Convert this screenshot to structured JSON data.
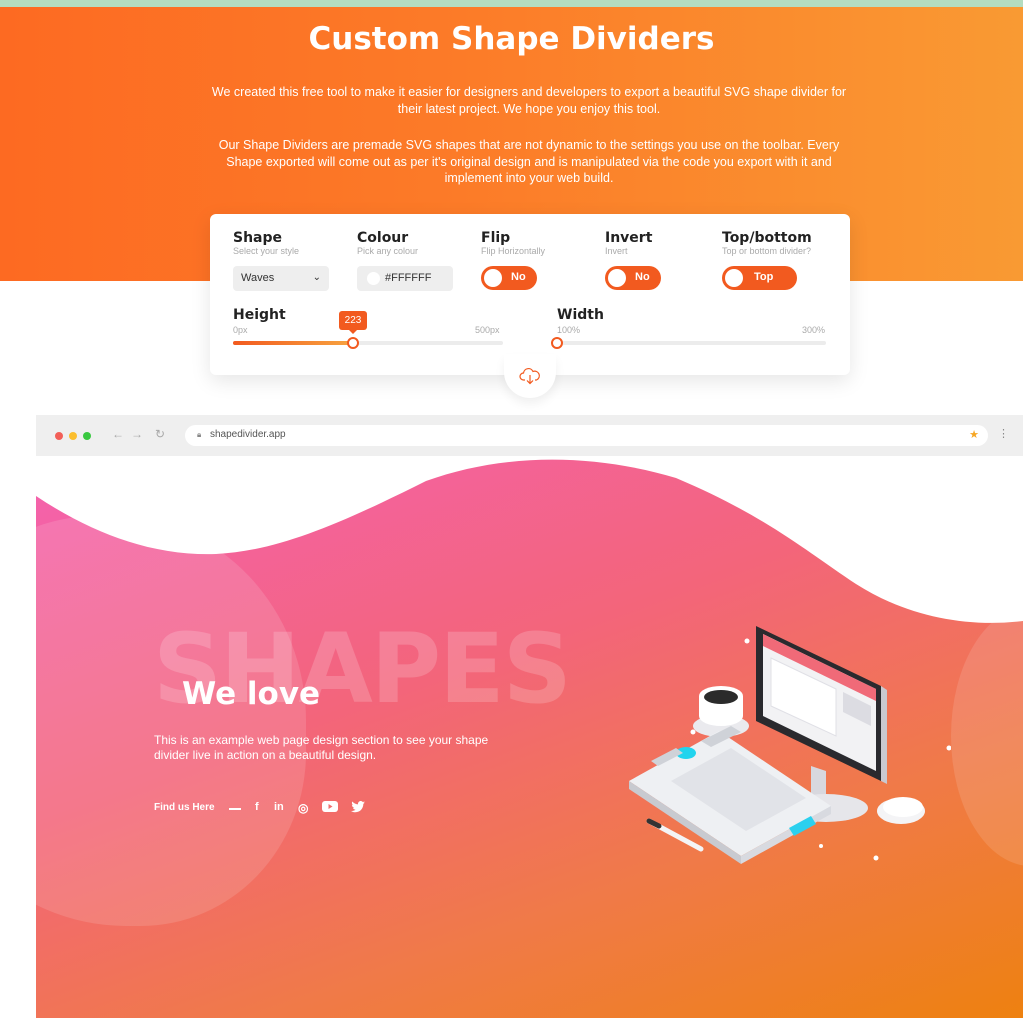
{
  "page": {
    "title": "Custom Shape Dividers",
    "intro_line1": "We created this free tool to make it easier for designers and developers to export a beautiful SVG shape divider for their latest project. We hope you enjoy this tool.",
    "intro_line2": "Our Shape Dividers are premade SVG shapes that are not dynamic to the settings you use on the toolbar. Every Shape exported will come out as per it's original design and is manipulated via the code you export with it and implement into your web build."
  },
  "toolbar": {
    "shape": {
      "label": "Shape",
      "sub": "Select your style",
      "value": "Waves"
    },
    "colour": {
      "label": "Colour",
      "sub": "Pick any colour",
      "value": "#FFFFFF"
    },
    "flip": {
      "label": "Flip",
      "sub": "Flip Horizontally",
      "state": "No"
    },
    "invert": {
      "label": "Invert",
      "sub": "Invert",
      "state": "No"
    },
    "topbottom": {
      "label": "Top/bottom",
      "sub": "Top or bottom divider?",
      "state": "Top"
    },
    "height": {
      "label": "Height",
      "min": "0px",
      "max": "500px",
      "value": "223"
    },
    "width": {
      "label": "Width",
      "min": "100%",
      "max": "300%"
    },
    "download_icon": "cloud-download-icon"
  },
  "preview": {
    "url": "shapedivider.app",
    "big_word": "SHAPES",
    "headline": "We love",
    "body": "This is an example web page design section to see your shape divider live in action on a beautiful design.",
    "find_us": "Find us Here",
    "social_icons": [
      "facebook-icon",
      "linkedin-icon",
      "instagram-icon",
      "youtube-icon",
      "twitter-icon"
    ]
  },
  "colors": {
    "accent": "#f25a1f",
    "hero_start": "#fd6a22",
    "hero_end": "#f99a33"
  }
}
